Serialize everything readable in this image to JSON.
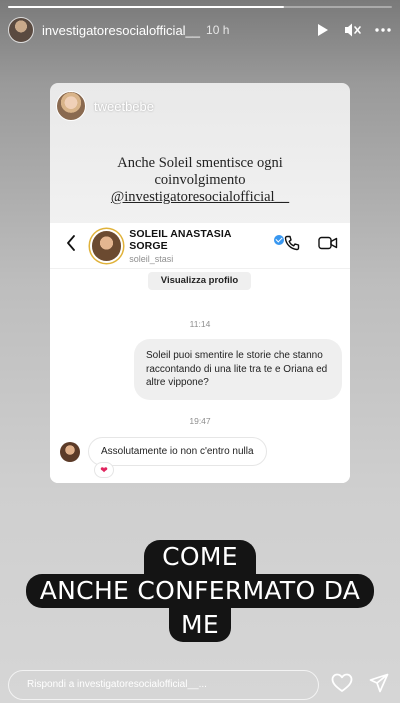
{
  "story": {
    "progress_fraction": 0.72,
    "username": "investigatoresocialofficial__",
    "time": "10 h"
  },
  "card": {
    "username": "tweetbebe",
    "quote_line1": "Anche Soleil smentisce ogni",
    "quote_line2": "coinvolgimento",
    "quote_handle": "@investigatoresocialofficial__"
  },
  "dm": {
    "name": "SOLEIL ANASTASIA SORGE",
    "handle": "soleil_stasi",
    "profile_button": "Visualizza profilo",
    "time1": "11:14",
    "message_sent": "Soleil puoi smentire le storie che stanno raccontando di una lite tra te e Oriana ed altre vippone?",
    "time2": "19:47",
    "message_received": "Assolutamente io non c'entro nulla",
    "reaction": "❤"
  },
  "caption": {
    "line1": "COME",
    "line2": "ANCHE CONFERMATO DA",
    "line3": "ME"
  },
  "reply": {
    "placeholder": "Rispondi a investigatoresocialofficial__..."
  },
  "icons": {
    "play": "play-icon",
    "mute": "mute-icon",
    "more": "more-icon",
    "heart": "heart-icon",
    "send": "send-icon"
  }
}
